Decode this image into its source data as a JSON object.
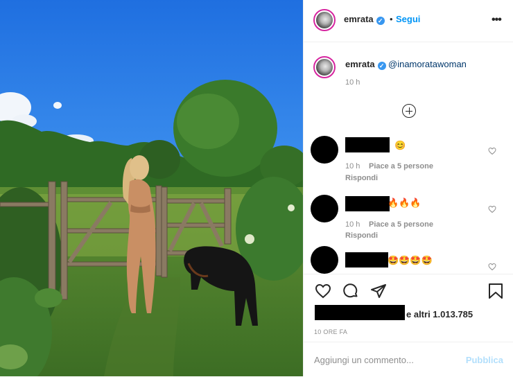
{
  "post": {
    "username": "emrata",
    "follow_label": "Segui",
    "separator": "•",
    "more_icon": "more-options-icon"
  },
  "caption": {
    "username": "emrata",
    "mention": "@inamoratawoman",
    "time": "10 h"
  },
  "comments": [
    {
      "emoji": "😊",
      "time": "10 h",
      "likes": "Piace a 5 persone",
      "reply": "Rispondi"
    },
    {
      "emoji": "🔥🔥🔥",
      "time": "10 h",
      "likes": "Piace a 5 persone",
      "reply": "Rispondi"
    },
    {
      "emoji": "🤩🤩🤩🤩"
    }
  ],
  "likes_suffix": "e altri 1.013.785",
  "posted_ago": "10 ORE FA",
  "add_comment_placeholder": "Aggiungi un commento...",
  "publish_label": "Pubblica",
  "colors": {
    "link_blue": "#0095f6",
    "verified_blue": "#3897f0",
    "muted_gray": "#8e8e8e"
  }
}
